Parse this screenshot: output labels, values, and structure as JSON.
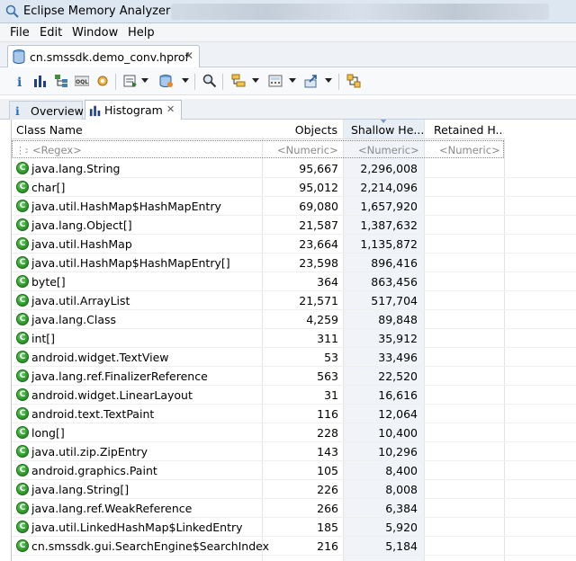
{
  "window": {
    "title": "Eclipse Memory Analyzer"
  },
  "menu": [
    "File",
    "Edit",
    "Window",
    "Help"
  ],
  "editor_tab": {
    "label": "cn.smssdk.demo_conv.hprof",
    "close": "✕"
  },
  "view_tabs": [
    {
      "label": "Overview",
      "icon": "info-icon"
    },
    {
      "label": "Histogram",
      "icon": "histogram-icon",
      "close": "✕"
    }
  ],
  "table": {
    "columns": [
      "Class Name",
      "Objects",
      "Shallow He...",
      "Retained H..."
    ],
    "filters": [
      "<Regex>",
      "<Numeric>",
      "<Numeric>",
      "<Numeric>"
    ],
    "rows": [
      {
        "name": "java.lang.String",
        "objects": "95,667",
        "shallow": "2,296,008"
      },
      {
        "name": "char[]",
        "objects": "95,012",
        "shallow": "2,214,096"
      },
      {
        "name": "java.util.HashMap$HashMapEntry",
        "objects": "69,080",
        "shallow": "1,657,920"
      },
      {
        "name": "java.lang.Object[]",
        "objects": "21,587",
        "shallow": "1,387,632"
      },
      {
        "name": "java.util.HashMap",
        "objects": "23,664",
        "shallow": "1,135,872"
      },
      {
        "name": "java.util.HashMap$HashMapEntry[]",
        "objects": "23,598",
        "shallow": "896,416"
      },
      {
        "name": "byte[]",
        "objects": "364",
        "shallow": "863,456"
      },
      {
        "name": "java.util.ArrayList",
        "objects": "21,571",
        "shallow": "517,704"
      },
      {
        "name": "java.lang.Class",
        "objects": "4,259",
        "shallow": "89,848"
      },
      {
        "name": "int[]",
        "objects": "311",
        "shallow": "35,912"
      },
      {
        "name": "android.widget.TextView",
        "objects": "53",
        "shallow": "33,496"
      },
      {
        "name": "java.lang.ref.FinalizerReference",
        "objects": "563",
        "shallow": "22,520"
      },
      {
        "name": "android.widget.LinearLayout",
        "objects": "31",
        "shallow": "16,616"
      },
      {
        "name": "android.text.TextPaint",
        "objects": "116",
        "shallow": "12,064"
      },
      {
        "name": "long[]",
        "objects": "228",
        "shallow": "10,400"
      },
      {
        "name": "java.util.zip.ZipEntry",
        "objects": "143",
        "shallow": "10,296"
      },
      {
        "name": "android.graphics.Paint",
        "objects": "105",
        "shallow": "8,400"
      },
      {
        "name": "java.lang.String[]",
        "objects": "226",
        "shallow": "8,008"
      },
      {
        "name": "java.lang.ref.WeakReference",
        "objects": "266",
        "shallow": "6,384"
      },
      {
        "name": "java.util.LinkedHashMap$LinkedEntry",
        "objects": "185",
        "shallow": "5,920"
      },
      {
        "name": "cn.smssdk.gui.SearchEngine$SearchIndex",
        "objects": "216",
        "shallow": "5,184"
      }
    ],
    "class_icon_letter": "C"
  }
}
